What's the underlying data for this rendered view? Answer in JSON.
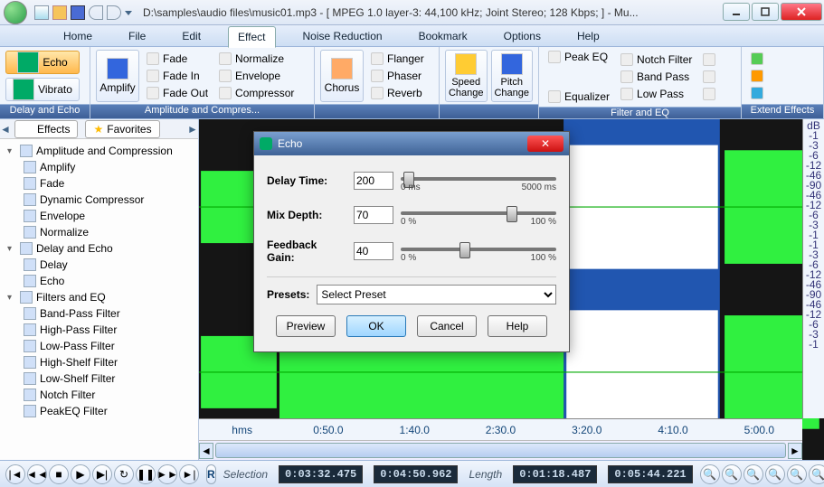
{
  "title": "D:\\samples\\audio files\\music01.mp3 - [ MPEG 1.0 layer-3: 44,100 kHz; Joint Stereo; 128 Kbps;  ] - Mu...",
  "menu": {
    "home": "Home",
    "file": "File",
    "edit": "Edit",
    "effect": "Effect",
    "noise": "Noise Reduction",
    "bookmark": "Bookmark",
    "options": "Options",
    "help": "Help"
  },
  "ribbon": {
    "g1": {
      "title": "Delay and Echo",
      "echo": "Echo",
      "vibrato": "Vibrato"
    },
    "g2": {
      "title": "Amplitude and Compres...",
      "amplify": "Amplify",
      "fade": "Fade",
      "fadein": "Fade In",
      "fadeout": "Fade Out",
      "normalize": "Normalize",
      "envelope": "Envelope",
      "compressor": "Compressor"
    },
    "g3": {
      "title": "",
      "chorus": "Chorus",
      "flanger": "Flanger",
      "phaser": "Phaser",
      "reverb": "Reverb"
    },
    "g4": {
      "title": "",
      "speed": "Speed\nChange",
      "pitch": "Pitch\nChange"
    },
    "g5": {
      "title": "Filter and EQ",
      "peakeq": "Peak EQ",
      "equalizer": "Equalizer",
      "notch": "Notch Filter",
      "bandpass": "Band Pass",
      "lowpass": "Low Pass"
    },
    "g6": {
      "title": "Extend Effects"
    }
  },
  "left": {
    "tab_effects": "Effects",
    "tab_fav": "Favorites",
    "groups": [
      {
        "name": "Amplitude and Compression",
        "items": [
          "Amplify",
          "Fade",
          "Dynamic Compressor",
          "Envelope",
          "Normalize"
        ]
      },
      {
        "name": "Delay and Echo",
        "items": [
          "Delay",
          "Echo"
        ]
      },
      {
        "name": "Filters and EQ",
        "items": [
          "Band-Pass Filter",
          "High-Pass Filter",
          "Low-Pass Filter",
          "High-Shelf Filter",
          "Low-Shelf Filter",
          "Notch Filter",
          "PeakEQ Filter"
        ]
      }
    ]
  },
  "time_ticks": [
    "hms",
    "0:50.0",
    "1:40.0",
    "2:30.0",
    "3:20.0",
    "4:10.0",
    "5:00.0"
  ],
  "db_ticks": [
    "dB",
    "-1",
    "-3",
    "-6",
    "-12",
    "-46",
    "-90",
    "-46",
    "-12",
    "-6",
    "-3",
    "-1",
    "",
    "-1",
    "-3",
    "-6",
    "-12",
    "-46",
    "-90",
    "-46",
    "-12",
    "-6",
    "-3",
    "-1"
  ],
  "bottom": {
    "selection_label": "Selection",
    "sel_start": "0:03:32.475",
    "sel_end": "0:04:50.962",
    "length_label": "Length",
    "len1": "0:01:18.487",
    "len2": "0:05:44.221",
    "rec": "R"
  },
  "dialog": {
    "title": "Echo",
    "delay_label": "Delay Time:",
    "delay_val": "200",
    "delay_min": "0 ms",
    "delay_max": "5000 ms",
    "mix_label": "Mix Depth:",
    "mix_val": "70",
    "mix_min": "0 %",
    "mix_max": "100 %",
    "fb_label": "Feedback Gain:",
    "fb_val": "40",
    "fb_min": "0 %",
    "fb_max": "100 %",
    "presets_label": "Presets:",
    "presets_placeholder": "Select Preset",
    "preview": "Preview",
    "ok": "OK",
    "cancel": "Cancel",
    "help": "Help"
  }
}
